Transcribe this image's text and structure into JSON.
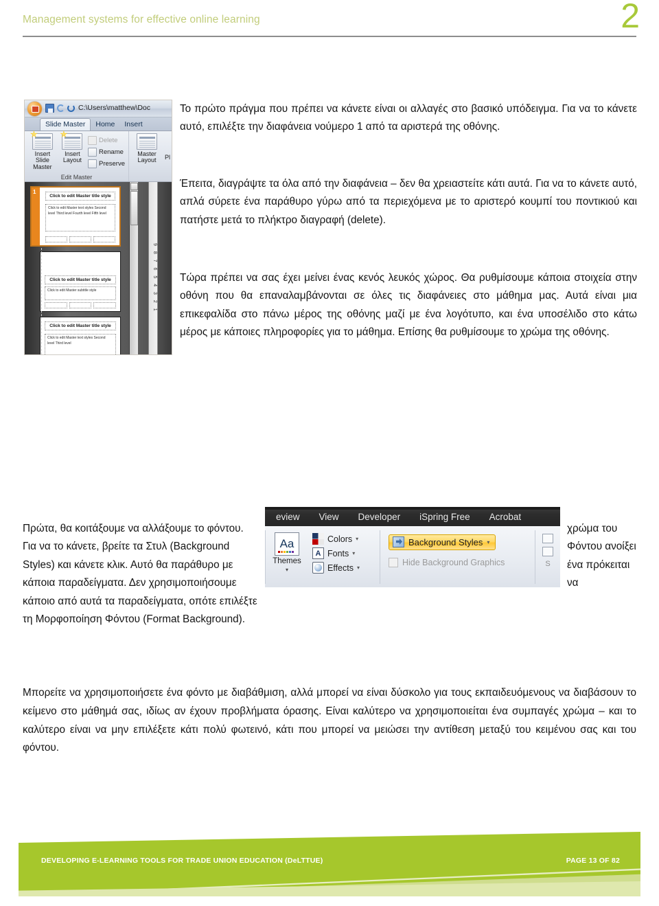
{
  "header": {
    "title": "Management systems for effective online learning",
    "page_number": "2",
    "title_color": "#c2cd7b",
    "number_color": "#a8c93a"
  },
  "ppt_screenshot": {
    "title_bar_path": "C:\\Users\\matthew\\Doc",
    "tabs": [
      "Slide Master",
      "Home",
      "Insert"
    ],
    "ribbon": {
      "insert_slide_master": "Insert Slide\nMaster",
      "insert_slide_master_line1": "Insert Slide",
      "insert_slide_master_line2": "Master",
      "insert_layout_line1": "Insert",
      "insert_layout_line2": "Layout",
      "delete": "Delete",
      "rename": "Rename",
      "preserve": "Preserve",
      "master_layout_line1": "Master",
      "master_layout_line2": "Layout",
      "placeholders_partial": "Pl",
      "group_label": "Edit Master"
    },
    "thumbnails": [
      {
        "number": "1",
        "title": "Click to edit Master title style",
        "body": "Click to edit Master text styles\n  Second level\n    Third level\n      Fourth level\n        Fifth level",
        "footers": [
          "",
          "",
          ""
        ],
        "selected": true
      },
      {
        "number": "",
        "title": "Click to edit Master title style",
        "body": "Click to edit Master subtitle style",
        "footers": [
          "",
          "",
          ""
        ],
        "selected": false
      },
      {
        "number": "",
        "title": "Click to edit Master title style",
        "body": "Click to edit Master text styles\n  Second level\n    Third level",
        "footers": [
          "",
          "",
          ""
        ],
        "selected": false
      }
    ],
    "ruler_marks": "9  8  7  6  5  4  3  2  1"
  },
  "paragraphs": {
    "p1": "Το πρώτο πράγμα που πρέπει να κάνετε είναι οι αλλαγές στο βασικό υπόδειγμα. Για να το κάνετε αυτό, επιλέξτε την διαφάνεια νούμερο 1 από τα αριστερά της οθόνης.",
    "p2": "Έπειτα, διαγράψτε τα όλα από την διαφάνεια – δεν θα χρειαστείτε κάτι αυτά. Για να το κάνετε αυτό, απλά σύρετε ένα παράθυρο γύρω από τα περιεχόμενα με το αριστερό κουμπί του ποντικιού και πατήστε μετά το πλήκτρο διαγραφή (delete).",
    "p3": "Τώρα πρέπει να σας έχει μείνει ένας κενός λευκός χώρος. Θα ρυθμίσουμε κάποια στοιχεία στην οθόνη που θα επαναλαμβάνονται σε όλες τις διαφάνειες στο μάθημα μας. Αυτά είναι μια επικεφαλίδα στο πάνω μέρος της οθόνης μαζί με ένα λογότυπο, και ένα υποσέλιδο στο κάτω μέρος με κάποιες πληροφορίες για το μάθημα. Επίσης θα ρυθμίσουμε το χρώμα της οθόνης.",
    "mid_left": "Πρώτα, θα κοιτάξουμε να αλλάξουμε το φόντου. Για να το κάνετε, βρείτε τα Στυλ (Background Styles) και κάνετε κλικ. Αυτό θα παράθυρο με κάποια παραδείγματα.  Δεν χρησιμοποιήσουμε κάποιο από αυτά τα παραδείγματα, οπότε επιλέξτε τη Μορφοποίηση Φόντου (Format Background).",
    "mid_right": "χρώμα του Φόντου ανοίξει ένα πρόκειται να",
    "p4": "Μπορείτε να χρησιμοποιήσετε ένα φόντο με διαβάθμιση, αλλά μπορεί να είναι δύσκολο για τους εκπαιδευόμενους να διαβάσουν το κείμενο στο μάθημά σας, ιδίως αν έχουν προβλήματα όρασης. Είναι καλύτερο να χρησιμοποιείται ένα συμπαγές χρώμα – και το καλύτερο είναι να μην επιλέξετε κάτι πολύ φωτεινό, κάτι που μπορεί να μειώσει την αντίθεση μεταξύ του κειμένου σας και του φόντου."
  },
  "ribbon_screenshot": {
    "tabs": [
      "eview",
      "View",
      "Developer",
      "iSpring Free",
      "Acrobat"
    ],
    "themes_label": "Themes",
    "themes_glyph": "Aa",
    "colors": "Colors",
    "fonts": "Fonts",
    "fonts_glyph": "A",
    "effects": "Effects",
    "background_styles": "Background Styles",
    "hide_background_graphics": "Hide Background Graphics",
    "right_partial_letter": "S",
    "highlight_color": "#ffd969"
  },
  "footer": {
    "left_text": "DEVELOPING E-LEARNING TOOLS FOR TRADE UNION EDUCATION (DeLTTUE)",
    "right_text": "PAGE 13 OF 82",
    "band_color": "#a6c72c"
  }
}
